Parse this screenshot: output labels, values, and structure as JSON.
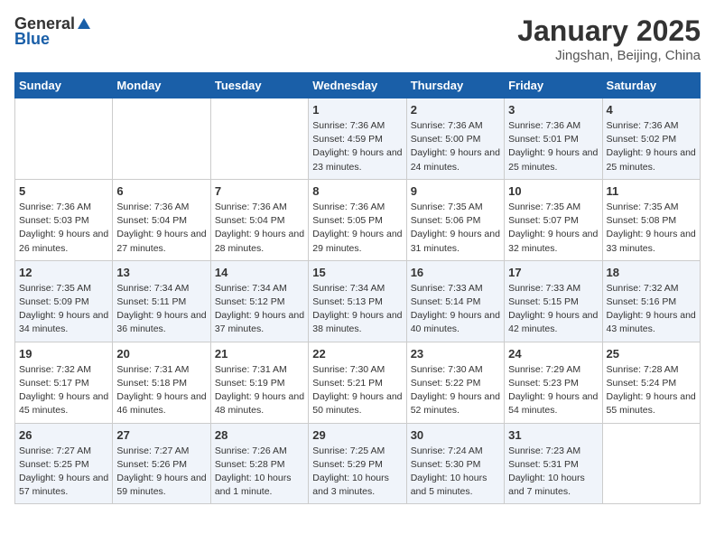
{
  "header": {
    "logo_general": "General",
    "logo_blue": "Blue",
    "month": "January 2025",
    "location": "Jingshan, Beijing, China"
  },
  "weekdays": [
    "Sunday",
    "Monday",
    "Tuesday",
    "Wednesday",
    "Thursday",
    "Friday",
    "Saturday"
  ],
  "weeks": [
    [
      {
        "day": "",
        "sunrise": "",
        "sunset": "",
        "daylight": ""
      },
      {
        "day": "",
        "sunrise": "",
        "sunset": "",
        "daylight": ""
      },
      {
        "day": "",
        "sunrise": "",
        "sunset": "",
        "daylight": ""
      },
      {
        "day": "1",
        "sunrise": "Sunrise: 7:36 AM",
        "sunset": "Sunset: 4:59 PM",
        "daylight": "Daylight: 9 hours and 23 minutes."
      },
      {
        "day": "2",
        "sunrise": "Sunrise: 7:36 AM",
        "sunset": "Sunset: 5:00 PM",
        "daylight": "Daylight: 9 hours and 24 minutes."
      },
      {
        "day": "3",
        "sunrise": "Sunrise: 7:36 AM",
        "sunset": "Sunset: 5:01 PM",
        "daylight": "Daylight: 9 hours and 25 minutes."
      },
      {
        "day": "4",
        "sunrise": "Sunrise: 7:36 AM",
        "sunset": "Sunset: 5:02 PM",
        "daylight": "Daylight: 9 hours and 25 minutes."
      }
    ],
    [
      {
        "day": "5",
        "sunrise": "Sunrise: 7:36 AM",
        "sunset": "Sunset: 5:03 PM",
        "daylight": "Daylight: 9 hours and 26 minutes."
      },
      {
        "day": "6",
        "sunrise": "Sunrise: 7:36 AM",
        "sunset": "Sunset: 5:04 PM",
        "daylight": "Daylight: 9 hours and 27 minutes."
      },
      {
        "day": "7",
        "sunrise": "Sunrise: 7:36 AM",
        "sunset": "Sunset: 5:04 PM",
        "daylight": "Daylight: 9 hours and 28 minutes."
      },
      {
        "day": "8",
        "sunrise": "Sunrise: 7:36 AM",
        "sunset": "Sunset: 5:05 PM",
        "daylight": "Daylight: 9 hours and 29 minutes."
      },
      {
        "day": "9",
        "sunrise": "Sunrise: 7:35 AM",
        "sunset": "Sunset: 5:06 PM",
        "daylight": "Daylight: 9 hours and 31 minutes."
      },
      {
        "day": "10",
        "sunrise": "Sunrise: 7:35 AM",
        "sunset": "Sunset: 5:07 PM",
        "daylight": "Daylight: 9 hours and 32 minutes."
      },
      {
        "day": "11",
        "sunrise": "Sunrise: 7:35 AM",
        "sunset": "Sunset: 5:08 PM",
        "daylight": "Daylight: 9 hours and 33 minutes."
      }
    ],
    [
      {
        "day": "12",
        "sunrise": "Sunrise: 7:35 AM",
        "sunset": "Sunset: 5:09 PM",
        "daylight": "Daylight: 9 hours and 34 minutes."
      },
      {
        "day": "13",
        "sunrise": "Sunrise: 7:34 AM",
        "sunset": "Sunset: 5:11 PM",
        "daylight": "Daylight: 9 hours and 36 minutes."
      },
      {
        "day": "14",
        "sunrise": "Sunrise: 7:34 AM",
        "sunset": "Sunset: 5:12 PM",
        "daylight": "Daylight: 9 hours and 37 minutes."
      },
      {
        "day": "15",
        "sunrise": "Sunrise: 7:34 AM",
        "sunset": "Sunset: 5:13 PM",
        "daylight": "Daylight: 9 hours and 38 minutes."
      },
      {
        "day": "16",
        "sunrise": "Sunrise: 7:33 AM",
        "sunset": "Sunset: 5:14 PM",
        "daylight": "Daylight: 9 hours and 40 minutes."
      },
      {
        "day": "17",
        "sunrise": "Sunrise: 7:33 AM",
        "sunset": "Sunset: 5:15 PM",
        "daylight": "Daylight: 9 hours and 42 minutes."
      },
      {
        "day": "18",
        "sunrise": "Sunrise: 7:32 AM",
        "sunset": "Sunset: 5:16 PM",
        "daylight": "Daylight: 9 hours and 43 minutes."
      }
    ],
    [
      {
        "day": "19",
        "sunrise": "Sunrise: 7:32 AM",
        "sunset": "Sunset: 5:17 PM",
        "daylight": "Daylight: 9 hours and 45 minutes."
      },
      {
        "day": "20",
        "sunrise": "Sunrise: 7:31 AM",
        "sunset": "Sunset: 5:18 PM",
        "daylight": "Daylight: 9 hours and 46 minutes."
      },
      {
        "day": "21",
        "sunrise": "Sunrise: 7:31 AM",
        "sunset": "Sunset: 5:19 PM",
        "daylight": "Daylight: 9 hours and 48 minutes."
      },
      {
        "day": "22",
        "sunrise": "Sunrise: 7:30 AM",
        "sunset": "Sunset: 5:21 PM",
        "daylight": "Daylight: 9 hours and 50 minutes."
      },
      {
        "day": "23",
        "sunrise": "Sunrise: 7:30 AM",
        "sunset": "Sunset: 5:22 PM",
        "daylight": "Daylight: 9 hours and 52 minutes."
      },
      {
        "day": "24",
        "sunrise": "Sunrise: 7:29 AM",
        "sunset": "Sunset: 5:23 PM",
        "daylight": "Daylight: 9 hours and 54 minutes."
      },
      {
        "day": "25",
        "sunrise": "Sunrise: 7:28 AM",
        "sunset": "Sunset: 5:24 PM",
        "daylight": "Daylight: 9 hours and 55 minutes."
      }
    ],
    [
      {
        "day": "26",
        "sunrise": "Sunrise: 7:27 AM",
        "sunset": "Sunset: 5:25 PM",
        "daylight": "Daylight: 9 hours and 57 minutes."
      },
      {
        "day": "27",
        "sunrise": "Sunrise: 7:27 AM",
        "sunset": "Sunset: 5:26 PM",
        "daylight": "Daylight: 9 hours and 59 minutes."
      },
      {
        "day": "28",
        "sunrise": "Sunrise: 7:26 AM",
        "sunset": "Sunset: 5:28 PM",
        "daylight": "Daylight: 10 hours and 1 minute."
      },
      {
        "day": "29",
        "sunrise": "Sunrise: 7:25 AM",
        "sunset": "Sunset: 5:29 PM",
        "daylight": "Daylight: 10 hours and 3 minutes."
      },
      {
        "day": "30",
        "sunrise": "Sunrise: 7:24 AM",
        "sunset": "Sunset: 5:30 PM",
        "daylight": "Daylight: 10 hours and 5 minutes."
      },
      {
        "day": "31",
        "sunrise": "Sunrise: 7:23 AM",
        "sunset": "Sunset: 5:31 PM",
        "daylight": "Daylight: 10 hours and 7 minutes."
      },
      {
        "day": "",
        "sunrise": "",
        "sunset": "",
        "daylight": ""
      }
    ]
  ]
}
